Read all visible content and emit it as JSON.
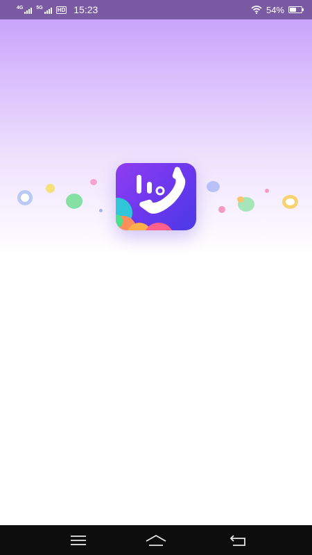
{
  "status_bar": {
    "network_1": "4G",
    "network_2": "5G",
    "hd_badge": "HD",
    "time": "15:23",
    "battery_percent": "54%",
    "battery_level": 0.54,
    "icons": [
      "signal-icon",
      "signal-icon",
      "hd-icon",
      "wifi-icon",
      "battery-icon"
    ]
  },
  "splash": {
    "app_icon": "phone-dialer-app-icon",
    "colors": {
      "gradient_top": "#c9a4fb",
      "icon_primary": "#7b3cf0",
      "status_bar": "#7a5aa3"
    }
  },
  "nav_bar": {
    "buttons": [
      "menu-icon",
      "home-icon",
      "back-icon"
    ]
  }
}
